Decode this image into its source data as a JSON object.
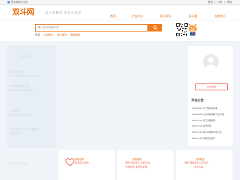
{
  "topbar": {
    "favorite": "显示桌面云平台",
    "links": [
      "登录",
      "注册",
      "帮助"
    ],
    "separator": "|"
  },
  "header": {
    "logo": "双斗网",
    "slogan": "双斗物量商 省支又精品",
    "nav": [
      {
        "label": "首页",
        "active": false
      },
      {
        "label": "产品中心",
        "active": false
      },
      {
        "label": "双斗资讯",
        "active": false
      },
      {
        "label": "双斗圈",
        "active": false
      },
      {
        "label": "应用中心",
        "active": false
      }
    ]
  },
  "search": {
    "placeholder": "输入 双斗商品/订货",
    "button_icon": "search-icon",
    "hot_label": "热搜:",
    "hot_keywords": [
      "订起服务",
      "双斗服务",
      "新鲜果蔬"
    ]
  },
  "sidebar": {
    "title": "双斗分类",
    "lines": [
      "双斗应用系统",
      "双斗订货 发送双斗中心的新版",
      "双斗服务新版小程序",
      "双斗商户中心新版小程序",
      "双斗服务号",
      "双斗物流系统 双斗中心",
      "双斗分销系统 双斗中心的新版",
      "一级分类 双斗",
      "双斗分销 双斗商品"
    ]
  },
  "user_panel": {
    "login_button": "企业登录",
    "notice_title": "平台公告",
    "notices": [
      "2016-09-22 关于网络连接事",
      "2016-08-25 业务系统部署 平台升级",
      "2016-07-25 员工管理规则",
      "2016-07-25 合同管理",
      "2016-07-25 客户管理新功能上线",
      "2016-07-25 功能优化提升"
    ]
  },
  "cards": [
    {
      "icon": "heart-icon",
      "title": "消防合规",
      "desc": [
        "依法防火依规",
        ""
      ]
    },
    {
      "icon": "",
      "title": "劳务保险",
      "desc": [
        "预防 风险发生 在防火线",
        "时常检查 更好的发展"
      ]
    },
    {
      "icon": "",
      "title": "合同规范",
      "desc": [
        "资质 明确企业入驻方式",
        "合作共赢"
      ]
    }
  ],
  "colors": {
    "brand": "#e36a0a",
    "accent": "#f07a17",
    "danger": "#e85a4f"
  }
}
